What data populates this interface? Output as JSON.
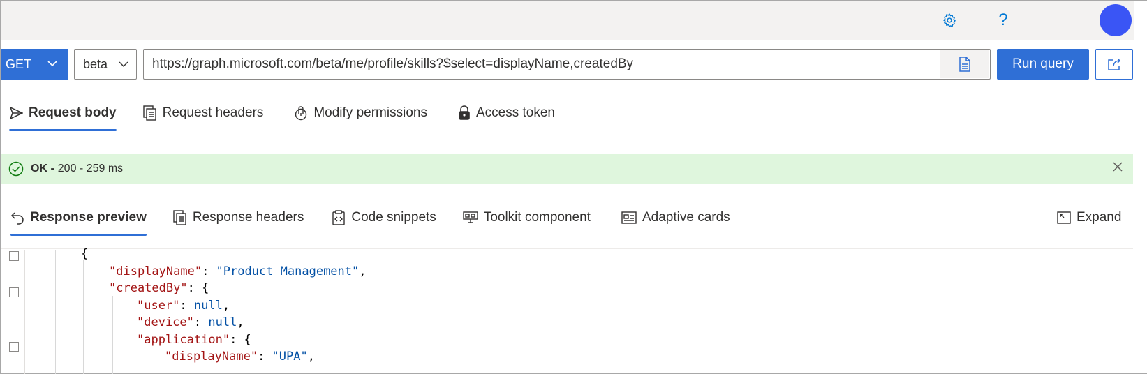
{
  "header": {
    "settings_icon": "gear-icon",
    "help_icon": "question-icon",
    "help_glyph": "?"
  },
  "request": {
    "method": "GET",
    "version": "beta",
    "url": "https://graph.microsoft.com/beta/me/profile/skills?$select=displayName,createdBy",
    "run_label": "Run query"
  },
  "request_tabs": [
    {
      "label": "Request body",
      "icon": "send-icon"
    },
    {
      "label": "Request headers",
      "icon": "headers-icon"
    },
    {
      "label": "Modify permissions",
      "icon": "permissions-icon"
    },
    {
      "label": "Access token",
      "icon": "lock-icon"
    }
  ],
  "status": {
    "label": "OK -",
    "detail": "200 - 259 ms"
  },
  "response_tabs": [
    {
      "label": "Response preview",
      "icon": "undo-arrow-icon"
    },
    {
      "label": "Response headers",
      "icon": "headers-icon"
    },
    {
      "label": "Code snippets",
      "icon": "code-clipboard-icon"
    },
    {
      "label": "Toolkit component",
      "icon": "toolkit-icon"
    },
    {
      "label": "Adaptive cards",
      "icon": "card-icon"
    }
  ],
  "expand_label": "Expand",
  "code": {
    "lines": [
      {
        "indent": 0,
        "text": "{"
      },
      {
        "indent": 1,
        "key": "\"displayName\"",
        "sep": ": ",
        "val": "\"Product Management\"",
        "end": ","
      },
      {
        "indent": 1,
        "key": "\"createdBy\"",
        "sep": ": ",
        "val": "{",
        "end": ""
      },
      {
        "indent": 2,
        "key": "\"user\"",
        "sep": ": ",
        "val": "null",
        "end": ","
      },
      {
        "indent": 2,
        "key": "\"device\"",
        "sep": ": ",
        "val": "null",
        "end": ","
      },
      {
        "indent": 2,
        "key": "\"application\"",
        "sep": ": ",
        "val": "{",
        "end": ""
      },
      {
        "indent": 3,
        "key": "\"displayName\"",
        "sep": ": ",
        "val": "\"UPA\"",
        "end": ","
      }
    ]
  },
  "colors": {
    "accent": "#2f6fd6",
    "success_bg": "#dff6dd",
    "avatar": "#3a55f5"
  }
}
